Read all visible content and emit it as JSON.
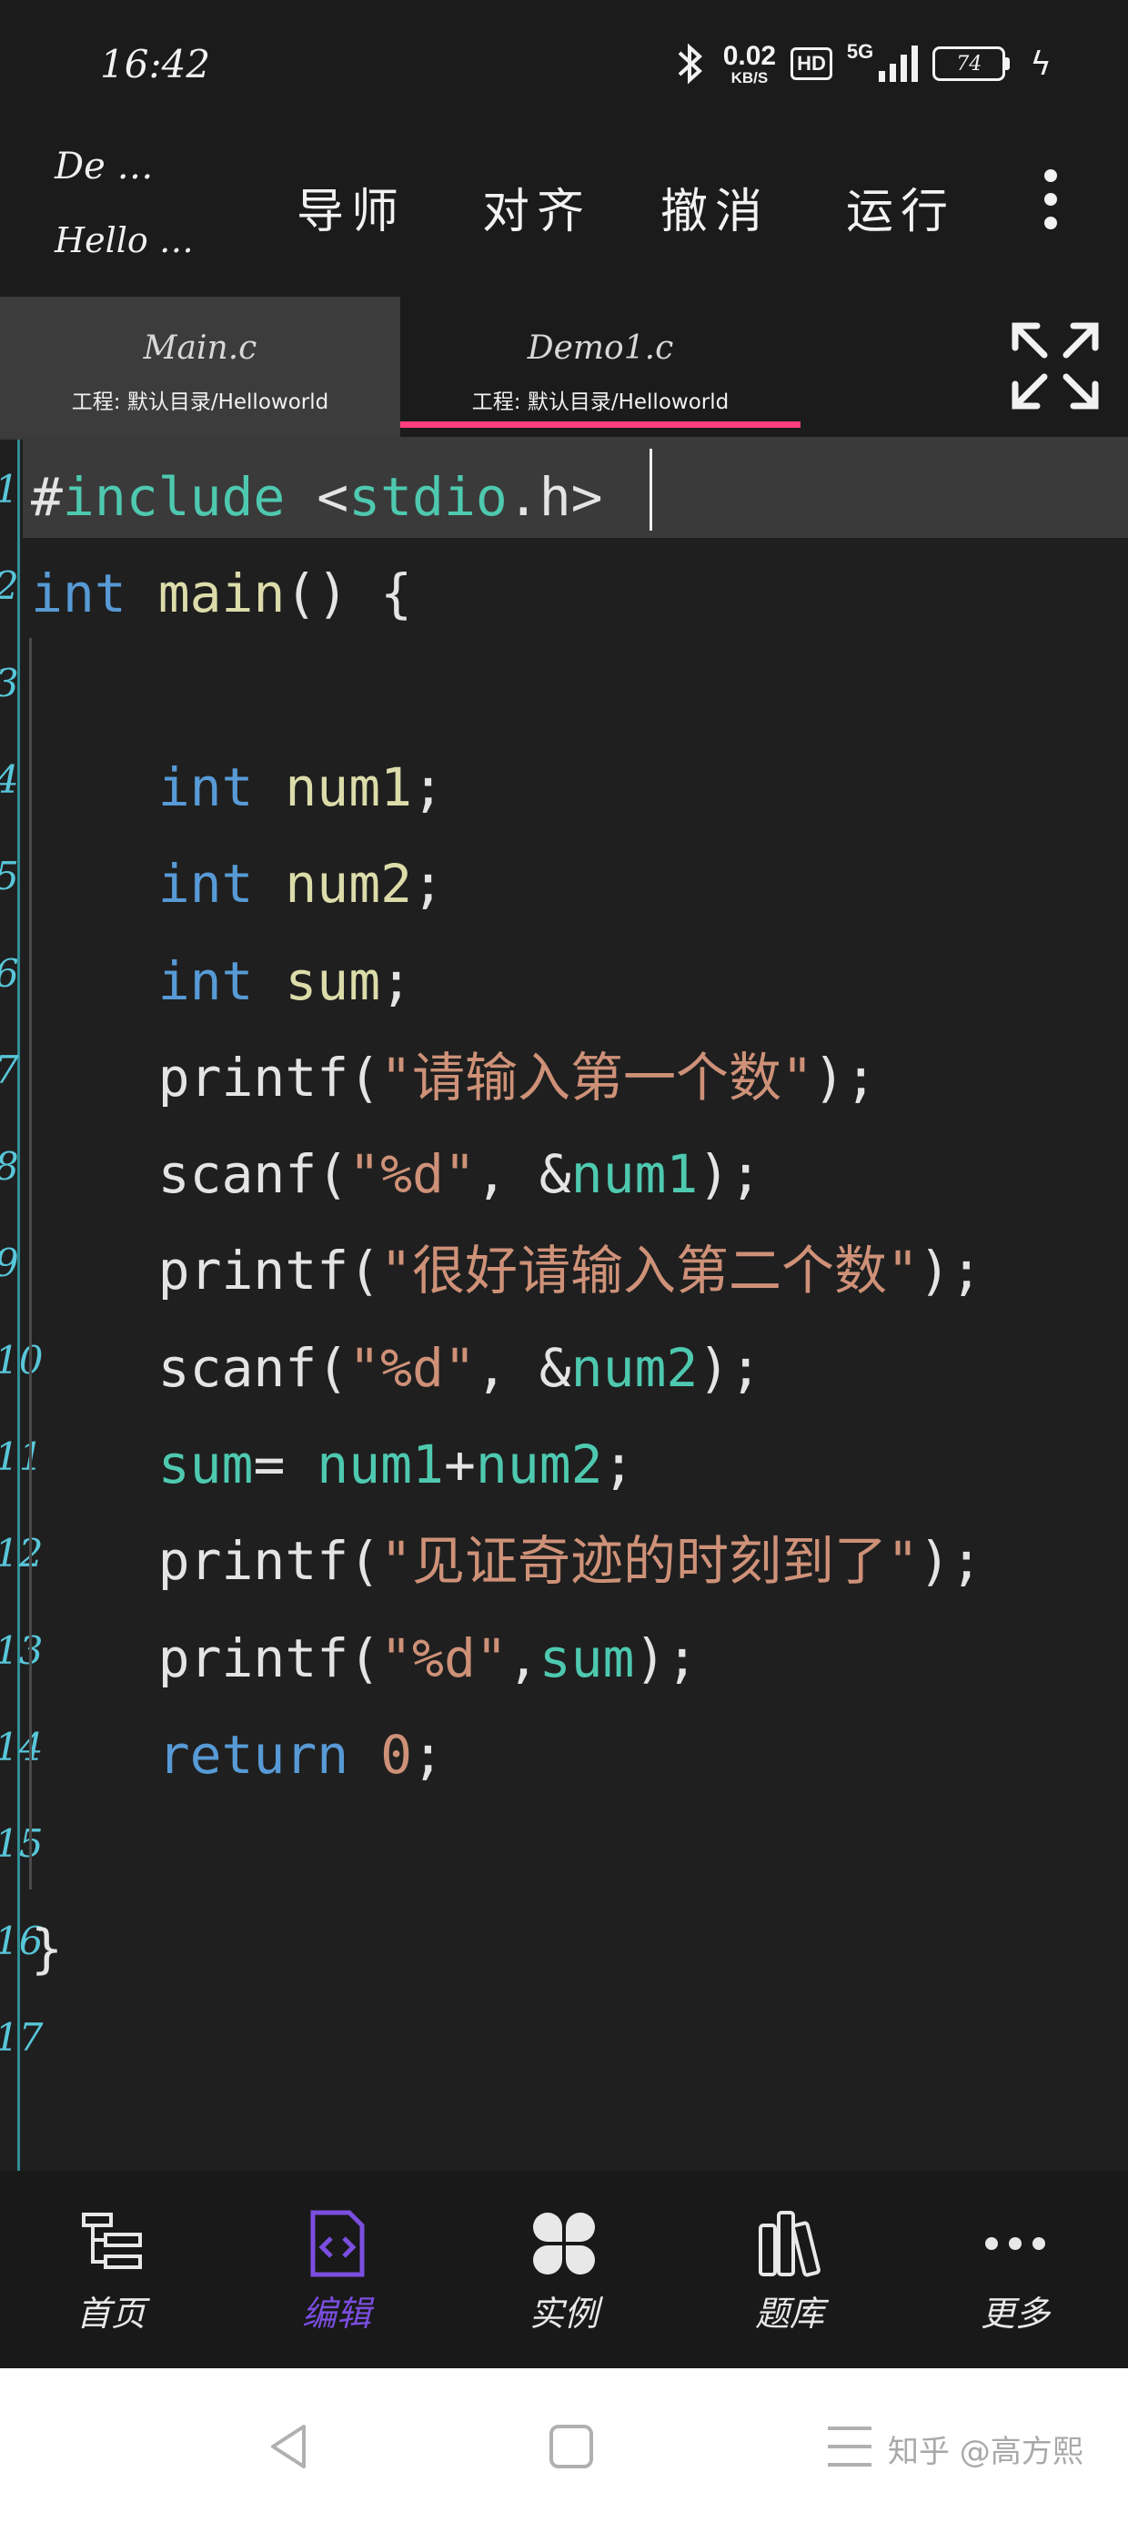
{
  "status_bar": {
    "time": "16:42",
    "net_speed_value": "0.02",
    "net_speed_unit": "KB/S",
    "hd": "HD",
    "network": "5G",
    "battery": "74"
  },
  "toolbar": {
    "file_name": "De …",
    "project_name": "Hello …",
    "menu": [
      "导师",
      "对齐",
      "撤消",
      "运行"
    ]
  },
  "tabs": [
    {
      "title": "Main.c",
      "subtitle": "工程: 默认目录/Helloworld",
      "active": false
    },
    {
      "title": "Demo1.c",
      "subtitle": "工程: 默认目录/Helloworld",
      "active": true
    }
  ],
  "editor": {
    "gutter": [
      "1",
      "2",
      "3",
      "4",
      "5",
      "6",
      "7",
      "8",
      "9",
      "10",
      "11",
      "12",
      "13",
      "14",
      "15",
      "16",
      "17"
    ],
    "code": [
      [
        [
          "#",
          "pl"
        ],
        [
          "include",
          "inc"
        ],
        [
          " <",
          "pl"
        ],
        [
          "stdio",
          "inc"
        ],
        [
          ".h>",
          "pl"
        ]
      ],
      [
        [
          "int",
          "ty"
        ],
        [
          " ",
          "pl"
        ],
        [
          "main",
          "id"
        ],
        [
          "() {",
          "pl"
        ]
      ],
      [],
      [
        [
          "    ",
          "pl"
        ],
        [
          "int",
          "ty"
        ],
        [
          " ",
          "pl"
        ],
        [
          "num1",
          "id"
        ],
        [
          ";",
          "pl"
        ]
      ],
      [
        [
          "    ",
          "pl"
        ],
        [
          "int",
          "ty"
        ],
        [
          " ",
          "pl"
        ],
        [
          "num2",
          "id"
        ],
        [
          ";",
          "pl"
        ]
      ],
      [
        [
          "    ",
          "pl"
        ],
        [
          "int",
          "ty"
        ],
        [
          " ",
          "pl"
        ],
        [
          "sum",
          "id"
        ],
        [
          ";",
          "pl"
        ]
      ],
      [
        [
          "    printf(",
          "pl"
        ],
        [
          "\"请输入第一个数\"",
          "str"
        ],
        [
          ");",
          "pl"
        ]
      ],
      [
        [
          "    scanf(",
          "pl"
        ],
        [
          "\"%d\"",
          "str"
        ],
        [
          ", &",
          "pl"
        ],
        [
          "num1",
          "var"
        ],
        [
          ");",
          "pl"
        ]
      ],
      [
        [
          "    printf(",
          "pl"
        ],
        [
          "\"很好请输入第二个数\"",
          "str"
        ],
        [
          ");",
          "pl"
        ]
      ],
      [
        [
          "    scanf(",
          "pl"
        ],
        [
          "\"%d\"",
          "str"
        ],
        [
          ", &",
          "pl"
        ],
        [
          "num2",
          "var"
        ],
        [
          ");",
          "pl"
        ]
      ],
      [
        [
          "    ",
          "pl"
        ],
        [
          "sum",
          "var"
        ],
        [
          "= ",
          "pl"
        ],
        [
          "num1",
          "var"
        ],
        [
          "+",
          "pl"
        ],
        [
          "num2",
          "var"
        ],
        [
          ";",
          "pl"
        ]
      ],
      [
        [
          "    printf(",
          "pl"
        ],
        [
          "\"见证奇迹的时刻到了\"",
          "str"
        ],
        [
          ");",
          "pl"
        ]
      ],
      [
        [
          "    printf(",
          "pl"
        ],
        [
          "\"%d\"",
          "str"
        ],
        [
          ",",
          "pl"
        ],
        [
          "sum",
          "var"
        ],
        [
          ");",
          "pl"
        ]
      ],
      [
        [
          "    ",
          "pl"
        ],
        [
          "return",
          "kw"
        ],
        [
          " ",
          "pl"
        ],
        [
          "0",
          "str"
        ],
        [
          ";",
          "pl"
        ]
      ],
      [],
      [
        [
          "}",
          "pl"
        ]
      ]
    ]
  },
  "bottom_nav": [
    {
      "label": "首页",
      "icon": "tree-list-icon",
      "active": false
    },
    {
      "label": "编辑",
      "icon": "code-file-icon",
      "active": true
    },
    {
      "label": "实例",
      "icon": "clover-icon",
      "active": false
    },
    {
      "label": "题库",
      "icon": "books-icon",
      "active": false
    },
    {
      "label": "更多",
      "icon": "ellipsis-icon",
      "active": false
    }
  ],
  "watermark": "知乎 @高方熙",
  "colors": {
    "accent": "#ff3d7f",
    "active_nav": "#7b4ee0",
    "keyword": "#579ad6",
    "string": "#ce9178",
    "identifier": "#dcdcaa",
    "variable": "#4ec9b0"
  }
}
